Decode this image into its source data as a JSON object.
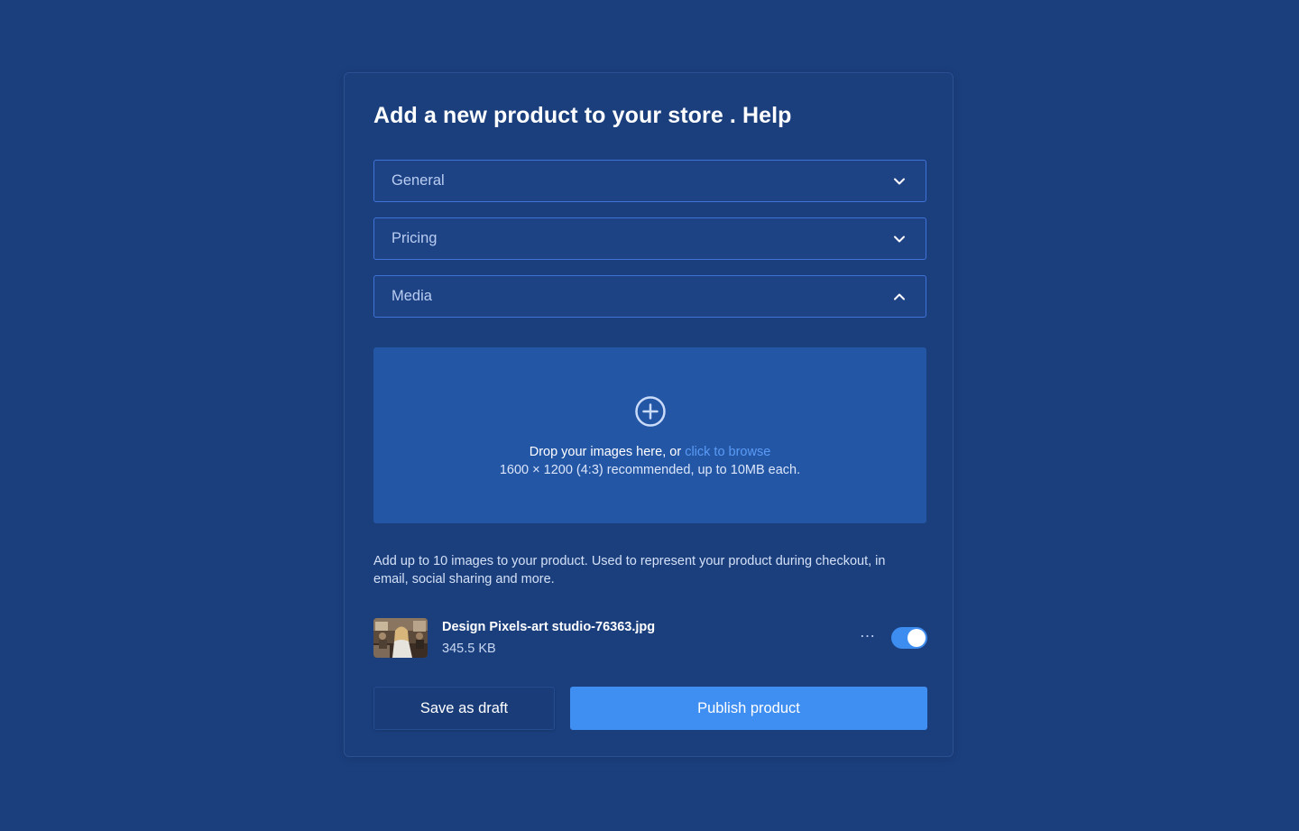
{
  "form": {
    "title": "Add a new product to your store . Help"
  },
  "sections": [
    {
      "label": "General",
      "state": "collapsed",
      "icon": "chevron-down-icon"
    },
    {
      "label": "Pricing",
      "state": "collapsed",
      "icon": "chevron-down-icon"
    },
    {
      "label": "Media",
      "state": "expanded",
      "icon": "chevron-up-icon"
    }
  ],
  "dropzone": {
    "icon": "plus-circle-icon",
    "text_prefix": "Drop your images here, or ",
    "link_text": "click to browse",
    "subtext": "1600 × 1200 (4:3) recommended, up to 10MB each."
  },
  "helper_text": "Add up to 10 images to your product. Used to represent your product during checkout, in email, social sharing and more.",
  "file": {
    "name": "Design Pixels-art studio-76363.jpg",
    "size": "345.5 KB",
    "more_icon": "more-horizontal-icon",
    "enabled": true
  },
  "actions": {
    "draft_label": "Save as draft",
    "publish_label": "Publish product"
  },
  "colors": {
    "background": "#1b3f7d",
    "accent": "#3f8ef2",
    "link": "#5a9bf5",
    "dropzone": "#2456a6"
  }
}
